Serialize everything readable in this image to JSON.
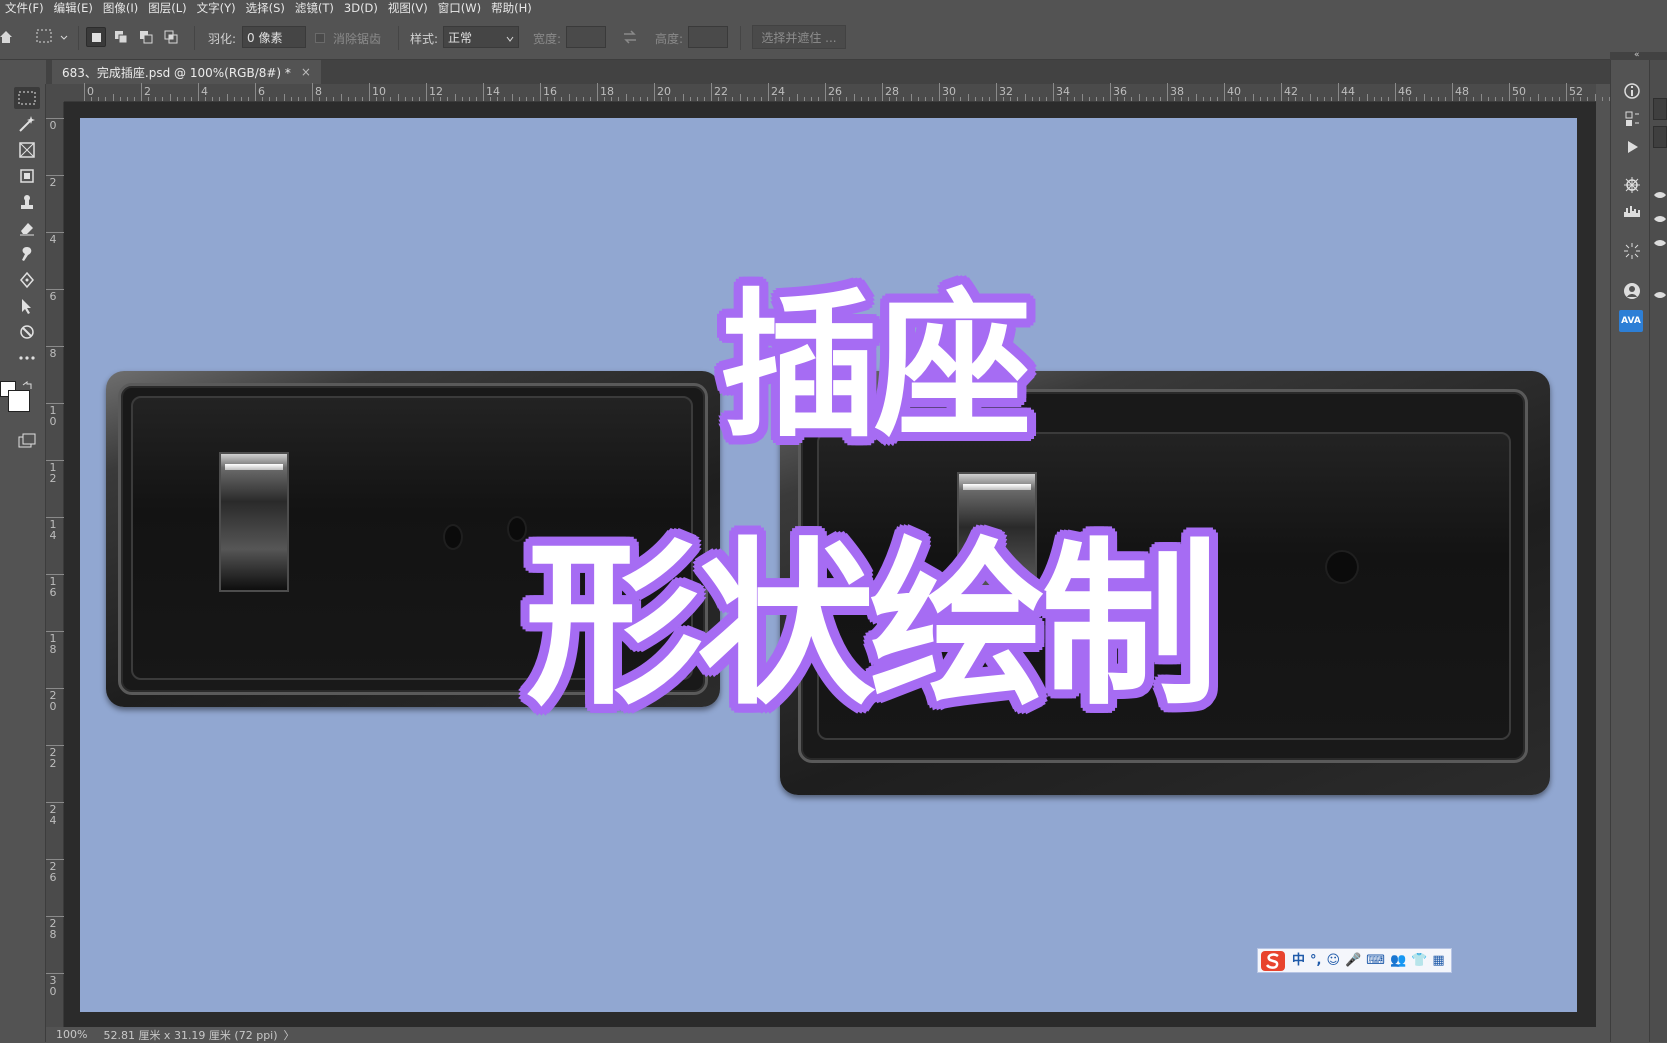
{
  "menu": [
    "文件(F)",
    "编辑(E)",
    "图像(I)",
    "图层(L)",
    "文字(Y)",
    "选择(S)",
    "滤镜(T)",
    "3D(D)",
    "视图(V)",
    "窗口(W)",
    "帮助(H)"
  ],
  "options": {
    "feather_label": "羽化:",
    "feather_value": "0 像素",
    "antialias_label": "消除锯齿",
    "style_label": "样式:",
    "style_value": "正常",
    "width_label": "宽度:",
    "height_label": "高度:",
    "select_mask": "选择并遮住 ..."
  },
  "tab": {
    "title": "683、完成插座.psd @ 100%(RGB/8#) *",
    "close": "×"
  },
  "ruler_h": [
    "0",
    "2",
    "4",
    "6",
    "8",
    "10",
    "12",
    "14",
    "16",
    "18",
    "20",
    "22",
    "24",
    "26",
    "28",
    "30",
    "32",
    "34",
    "36",
    "38",
    "40",
    "42",
    "44",
    "46",
    "48",
    "50",
    "52"
  ],
  "ruler_v": [
    "0",
    "2",
    "4",
    "6",
    "8",
    "10",
    "12",
    "14",
    "16",
    "18",
    "20",
    "22",
    "24",
    "26",
    "28",
    "30"
  ],
  "canvas": {
    "headline_top": "插座",
    "headline_bottom": "形状绘制",
    "accent_color": "#a66cf3",
    "background_color": "#91a7d1"
  },
  "ime": {
    "chars": [
      "中",
      "°,",
      "☺",
      "🎤",
      "⌨",
      "👥",
      "👕",
      "▦"
    ]
  },
  "right_dock": {
    "ava_label": "AVA"
  },
  "status": {
    "zoom": "100%",
    "doc_size": "52.81 厘米 x 31.19 厘米 (72 ppi)",
    "arrow": "〉"
  }
}
